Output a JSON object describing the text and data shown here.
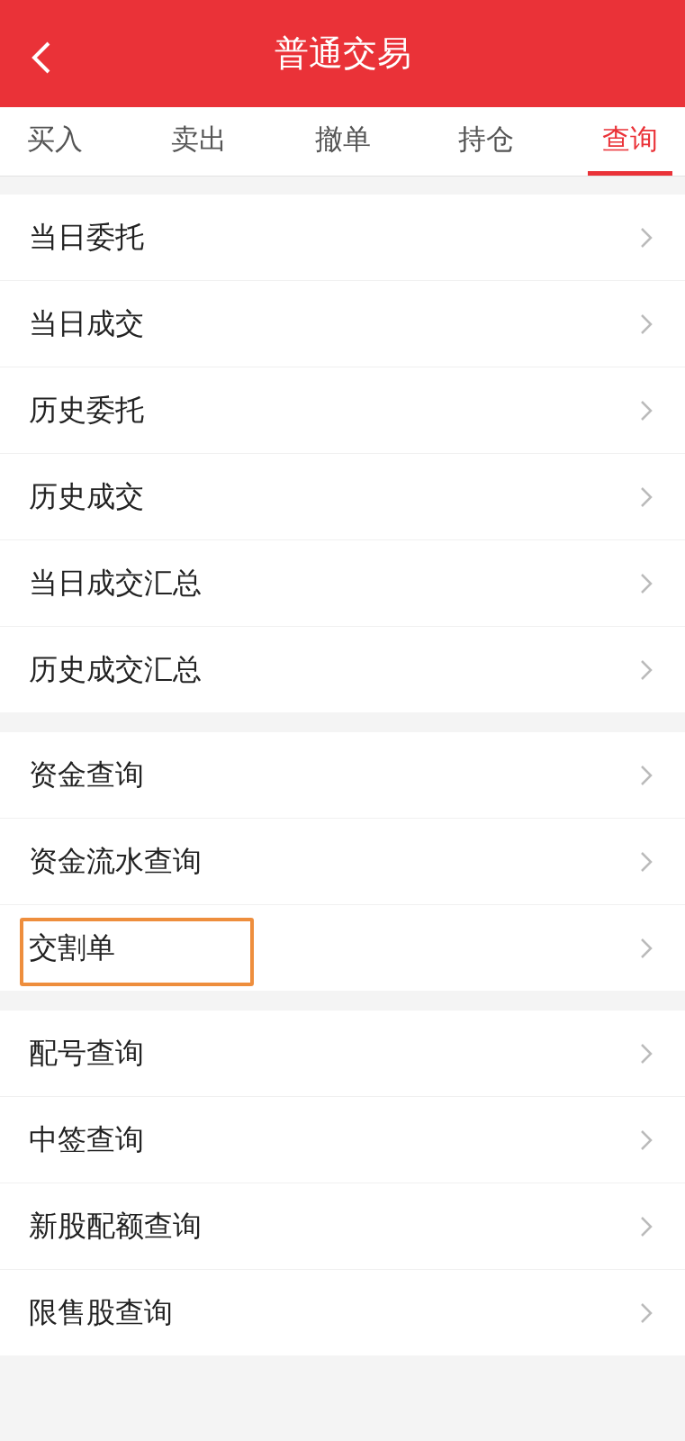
{
  "header": {
    "title": "普通交易"
  },
  "tabs": [
    {
      "label": "买入",
      "selected": false
    },
    {
      "label": "卖出",
      "selected": false
    },
    {
      "label": "撤单",
      "selected": false
    },
    {
      "label": "持仓",
      "selected": false
    },
    {
      "label": "查询",
      "selected": true
    }
  ],
  "groups": [
    {
      "items": [
        {
          "label": "当日委托",
          "highlighted": false
        },
        {
          "label": "当日成交",
          "highlighted": false
        },
        {
          "label": "历史委托",
          "highlighted": false
        },
        {
          "label": "历史成交",
          "highlighted": false
        },
        {
          "label": "当日成交汇总",
          "highlighted": false
        },
        {
          "label": "历史成交汇总",
          "highlighted": false
        }
      ]
    },
    {
      "items": [
        {
          "label": "资金查询",
          "highlighted": false
        },
        {
          "label": "资金流水查询",
          "highlighted": false
        },
        {
          "label": "交割单",
          "highlighted": true
        }
      ]
    },
    {
      "items": [
        {
          "label": "配号查询",
          "highlighted": false
        },
        {
          "label": "中签查询",
          "highlighted": false
        },
        {
          "label": "新股配额查询",
          "highlighted": false
        },
        {
          "label": "限售股查询",
          "highlighted": false
        }
      ]
    }
  ]
}
